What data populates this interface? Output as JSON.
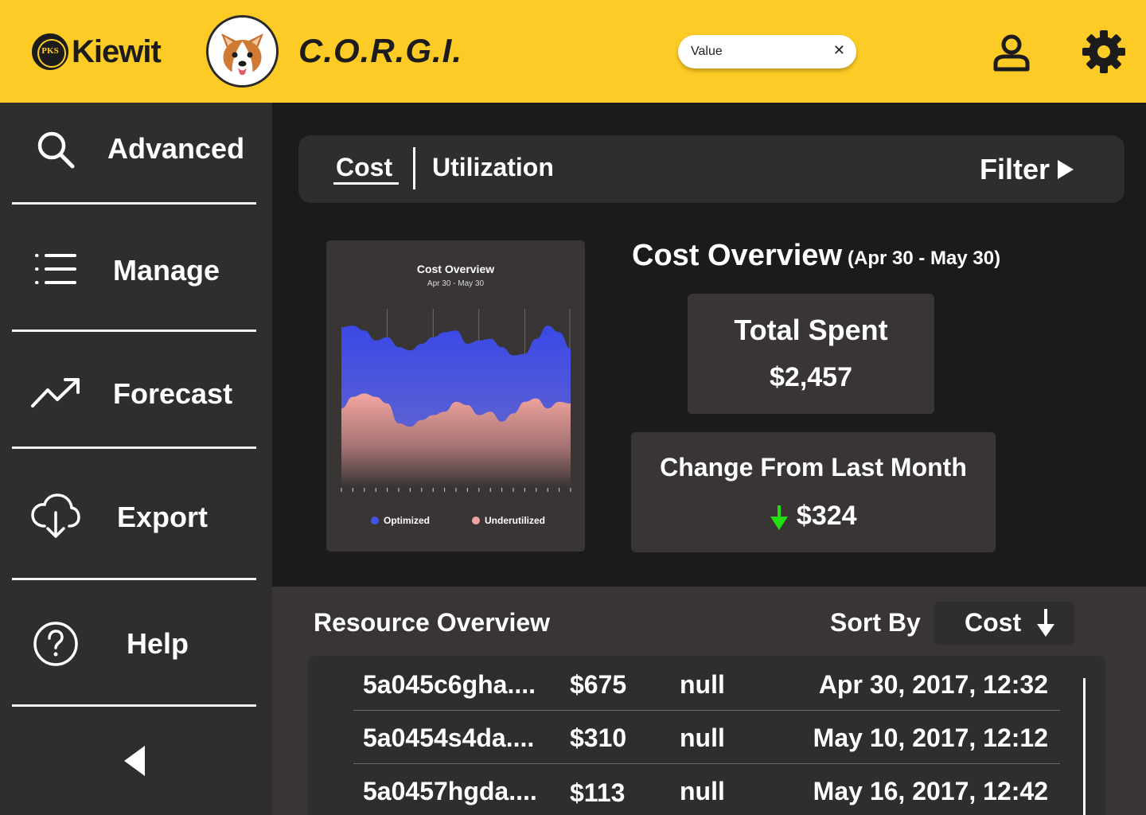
{
  "colors": {
    "header_bg": "#fdcb25",
    "sidebar_bg": "#2e2e2e",
    "main_bg": "#1b1b1b",
    "card_bg": "#3a3535",
    "optimized": "#4352e8",
    "underutilized": "#f0a4a0",
    "trend_down": "#22dd11"
  },
  "header": {
    "company_logo": {
      "text": "Kiewit",
      "seal_text": "PKS"
    },
    "mascot_icon": "corgi-avatar-icon",
    "app_title": "C.O.R.G.I.",
    "search": {
      "value": "Value",
      "clear_icon": "close-icon"
    },
    "user_icon": "user-icon",
    "settings_icon": "gear-icon"
  },
  "sidebar": {
    "items": [
      {
        "label": "Advanced",
        "icon": "search-icon"
      },
      {
        "label": "Manage",
        "icon": "list-icon"
      },
      {
        "label": "Forecast",
        "icon": "trending-up-icon"
      },
      {
        "label": "Export",
        "icon": "cloud-download-icon"
      },
      {
        "label": "Help",
        "icon": "help-circle-icon"
      }
    ],
    "collapse_icon": "chevron-left-icon"
  },
  "tabs": {
    "items": [
      {
        "label": "Cost",
        "active": true
      },
      {
        "label": "Utilization",
        "active": false
      }
    ],
    "filter_label": "Filter"
  },
  "chart_data": {
    "type": "area",
    "title": "Cost Overview",
    "subtitle": "Apr 30 - May 30",
    "x": [
      0,
      1,
      2,
      3,
      4,
      5,
      6,
      7,
      8,
      9,
      10,
      11,
      12,
      13,
      14,
      15,
      16,
      17,
      18,
      19,
      20
    ],
    "series": [
      {
        "name": "Optimized",
        "values": [
          96,
          97,
          94,
          88,
          90,
          84,
          82,
          86,
          90,
          93,
          94,
          86,
          88,
          89,
          84,
          79,
          80,
          89,
          97,
          93,
          83
        ]
      },
      {
        "name": "Underutilized",
        "values": [
          47,
          54,
          56,
          54,
          50,
          38,
          36,
          40,
          43,
          45,
          51,
          49,
          43,
          45,
          39,
          44,
          51,
          53,
          47,
          51,
          50
        ]
      }
    ],
    "ylim": [
      0,
      110
    ],
    "grid": true,
    "legend_position": "bottom"
  },
  "overview": {
    "title": "Cost Overview",
    "range": "(Apr 30 - May 30)",
    "total_spent": {
      "label": "Total Spent",
      "value": "$2,457"
    },
    "change": {
      "label": "Change From Last Month",
      "value": "$324",
      "direction_icon": "arrow-down-icon"
    }
  },
  "resources": {
    "title": "Resource Overview",
    "sort_label": "Sort By",
    "sort_value": "Cost",
    "rows": [
      {
        "id": "5a045c6gha....",
        "cost": "$675",
        "status": "null",
        "date": "Apr 30, 2017, 12:32"
      },
      {
        "id": "5a0454s4da....",
        "cost": "$310",
        "status": "null",
        "date": "May 10, 2017, 12:12"
      },
      {
        "id": "5a0457hgda....",
        "cost": "$113",
        "status": "null",
        "date": "May 16, 2017, 12:42"
      }
    ]
  }
}
